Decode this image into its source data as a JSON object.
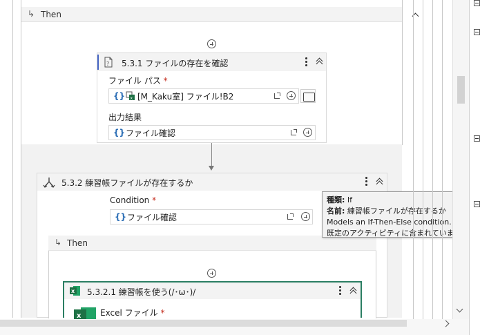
{
  "then_section": {
    "label": "Then"
  },
  "file_exists_card": {
    "title": "5.3.1 ファイルの存在を確認",
    "file_path_label": "ファイル パス",
    "required_mark": "*",
    "file_path_value": "[M_Kaku室] ファイル!B2",
    "output_label": "出力結果",
    "output_value": "ファイル確認"
  },
  "if_card": {
    "title": "5.3.2 練習帳ファイルが存在するか",
    "condition_label": "Condition",
    "required_mark": "*",
    "condition_value": "ファイル確認"
  },
  "tooltip": {
    "type_key": "種類:",
    "type_value": "If",
    "name_key": "名前:",
    "name_value": "練習帳ファイルが存在するか",
    "description": "Models an If-Then-Else condition.",
    "note": "既定のアクティビティに含まれています。"
  },
  "inner_then": {
    "label": "Then"
  },
  "excel_card": {
    "title": "5.3.2.1 練習帳を使う(/･ω･)/",
    "excel_file_label": "Excel ファイル",
    "required_mark": "*"
  },
  "colors": {
    "excel_green": "#1e7145",
    "excel_card_border": "#2a7e62",
    "file_card_accent": "#4464c4",
    "tooltip_bg": "#f2f2f2"
  }
}
